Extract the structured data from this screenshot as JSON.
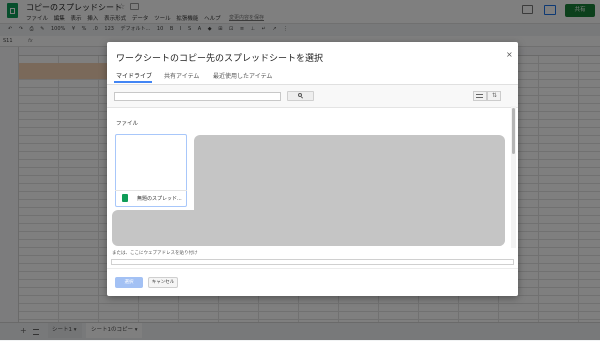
{
  "app": {
    "title": "コピーのスプレッドシート",
    "menus": [
      "ファイル",
      "編集",
      "表示",
      "挿入",
      "表示形式",
      "データ",
      "ツール",
      "拡張機能",
      "ヘルプ"
    ],
    "saved_status": "変更内容を保存",
    "share_label": "共有",
    "cell_ref": "S11",
    "toolbar": {
      "zoom": "100%",
      "currency": "¥",
      "percent": "%",
      "decimal": ".0",
      "number_format": "123",
      "font": "デフォルト...",
      "font_size": "10"
    },
    "sheet_tabs": [
      "シート1",
      "シート1のコピー"
    ],
    "accent_color": "#0f9d58"
  },
  "dialog": {
    "title": "ワークシートのコピー先のスプレッドシートを選択",
    "tabs": [
      "マイドライブ",
      "共有アイテム",
      "最近使用したアイテム"
    ],
    "active_tab": "マイドライブ",
    "files_label": "ファイル",
    "file_card_name": "無題のスプレッド...",
    "url_label": "または、ここにウェブアドレスを貼り付け",
    "select_label": "選択",
    "cancel_label": "キャンセル",
    "close_icon": "close-icon",
    "tab_accent": "#4285f4"
  }
}
